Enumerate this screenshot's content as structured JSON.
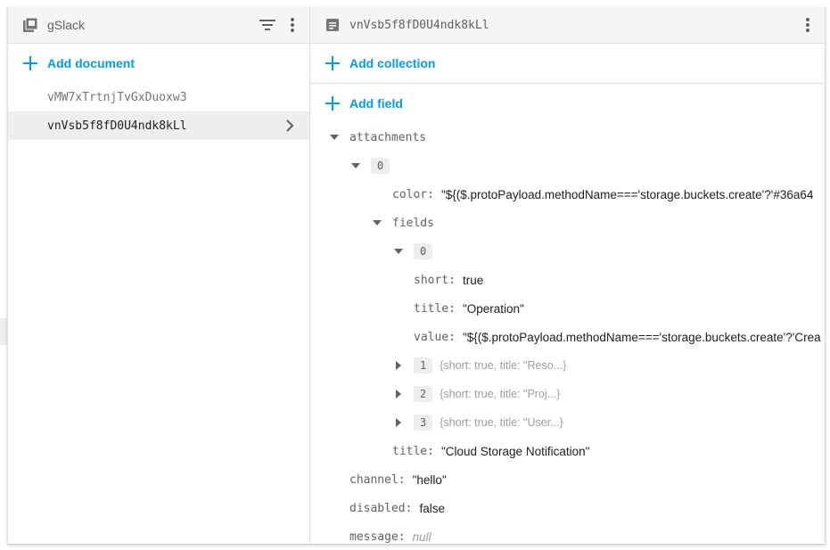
{
  "left": {
    "title": "gSlack",
    "add_label": "Add document",
    "documents": [
      "vMW7xTrtnjTvGxDuoxw3",
      "vnVsb5f8fD0U4ndk8kLl"
    ]
  },
  "right": {
    "title": "vnVsb5f8fD0U4ndk8kLl",
    "add_collection": "Add collection",
    "add_field": "Add field",
    "fields": {
      "attachments": "attachments",
      "idx0": "0",
      "color_key": "color",
      "color_val": "\"${($.protoPayload.methodName==='storage.buckets.create'?'#36a64",
      "fields_key": "fields",
      "f_idx0": "0",
      "short_key": "short",
      "short_val": "true",
      "title_key": "title",
      "title_val": "\"Operation\"",
      "value_key": "value",
      "value_val": "\"${($.protoPayload.methodName==='storage.buckets.create'?'Crea",
      "f_idx1": "1",
      "f_sum1": "{short: true, title: \"Reso...}",
      "f_idx2": "2",
      "f_sum2": "{short: true, title: \"Proj...}",
      "f_idx3": "3",
      "f_sum3": "{short: true, title: \"User...}",
      "att_title_key": "title",
      "att_title_val": "\"Cloud Storage Notification\"",
      "channel_key": "channel",
      "channel_val": "\"hello\"",
      "disabled_key": "disabled",
      "disabled_val": "false",
      "message_key": "message",
      "message_val": "null"
    }
  },
  "icons": {
    "collection": "collection-icon",
    "document": "document-icon",
    "filter": "filter-icon",
    "more": "more-vert-icon",
    "add": "add-icon",
    "chevron": "chevron-right-icon",
    "expanded": "caret-down-icon",
    "collapsed": "caret-right-icon"
  },
  "colors": {
    "accent": "#039be5",
    "header_bg": "#f5f5f5",
    "selected_bg": "#eeeeee"
  }
}
